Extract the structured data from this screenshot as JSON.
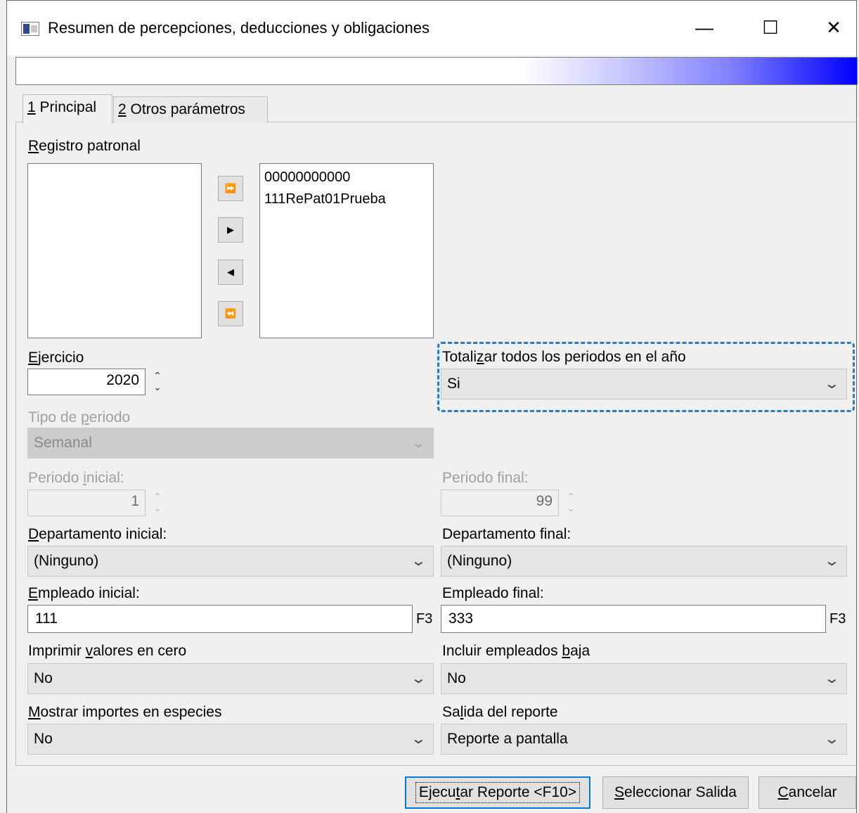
{
  "window": {
    "title": "Resumen de percepciones, deducciones y obligaciones",
    "minimize_glyph": "—",
    "maximize_glyph": "☐",
    "close_glyph": "✕"
  },
  "progress": {
    "value": 0
  },
  "tabs": [
    {
      "key": "1",
      "label": " Principal",
      "active": true
    },
    {
      "key": "2",
      "label": " Otros parámetros",
      "active": false
    }
  ],
  "registro": {
    "label_key": "R",
    "label_rest": "egistro patronal",
    "available": [],
    "selected": [
      "00000000000",
      "111RePat01Prueba"
    ],
    "buttons": {
      "add_all": "⏩",
      "add": "▶",
      "remove": "◀",
      "remove_all": "⏪"
    }
  },
  "ejercicio": {
    "label_key": "E",
    "label_rest": "jercicio",
    "value": "2020"
  },
  "totalizar": {
    "label_pre": "Totali",
    "label_key": "z",
    "label_post": "ar todos los periodos en el año",
    "value": "Si"
  },
  "tipo_periodo": {
    "label_pre": "Tipo de ",
    "label_key": "p",
    "label_post": "eriodo",
    "value": "Semanal"
  },
  "periodo_inicial": {
    "label_pre": "Periodo ",
    "label_key": "i",
    "label_post": "nicial:",
    "value": "1"
  },
  "periodo_final": {
    "label": "Periodo final:",
    "value": "99"
  },
  "departamento_inicial": {
    "label_key": "D",
    "label_rest": "epartamento inicial:",
    "value": "(Ninguno)"
  },
  "departamento_final": {
    "label": "Departamento final:",
    "value": "(Ninguno)"
  },
  "empleado_inicial": {
    "label_key": "E",
    "label_rest": "mpleado inicial:",
    "value": "111",
    "lookup": "F3"
  },
  "empleado_final": {
    "label": "Empleado final:",
    "value": "333",
    "lookup": "F3"
  },
  "imprimir_cero": {
    "label_pre": "Imprimir ",
    "label_key": "v",
    "label_post": "alores en cero",
    "value": "No"
  },
  "incluir_baja": {
    "label_pre": "Incluir empleados ",
    "label_key": "b",
    "label_post": "aja",
    "value": "No"
  },
  "mostrar_especies": {
    "label_key": "M",
    "label_rest": "ostrar importes en especies",
    "value": "No"
  },
  "salida": {
    "label_pre": "Sa",
    "label_key": "l",
    "label_post": "ida del reporte",
    "value": "Reporte a pantalla"
  },
  "buttons": {
    "ejecutar": {
      "pre": "E",
      "key": "j",
      "mid": "ecu",
      "key2": "t",
      "post": "ar Reporte <F10>"
    },
    "seleccionar": {
      "key": "S",
      "rest": "eleccionar Salida"
    },
    "cancelar": {
      "key": "C",
      "rest": "ancelar"
    }
  },
  "colors": {
    "progress_end": "#0000ff",
    "highlight": "#2b7bc0",
    "default_button": "#0078d7"
  }
}
